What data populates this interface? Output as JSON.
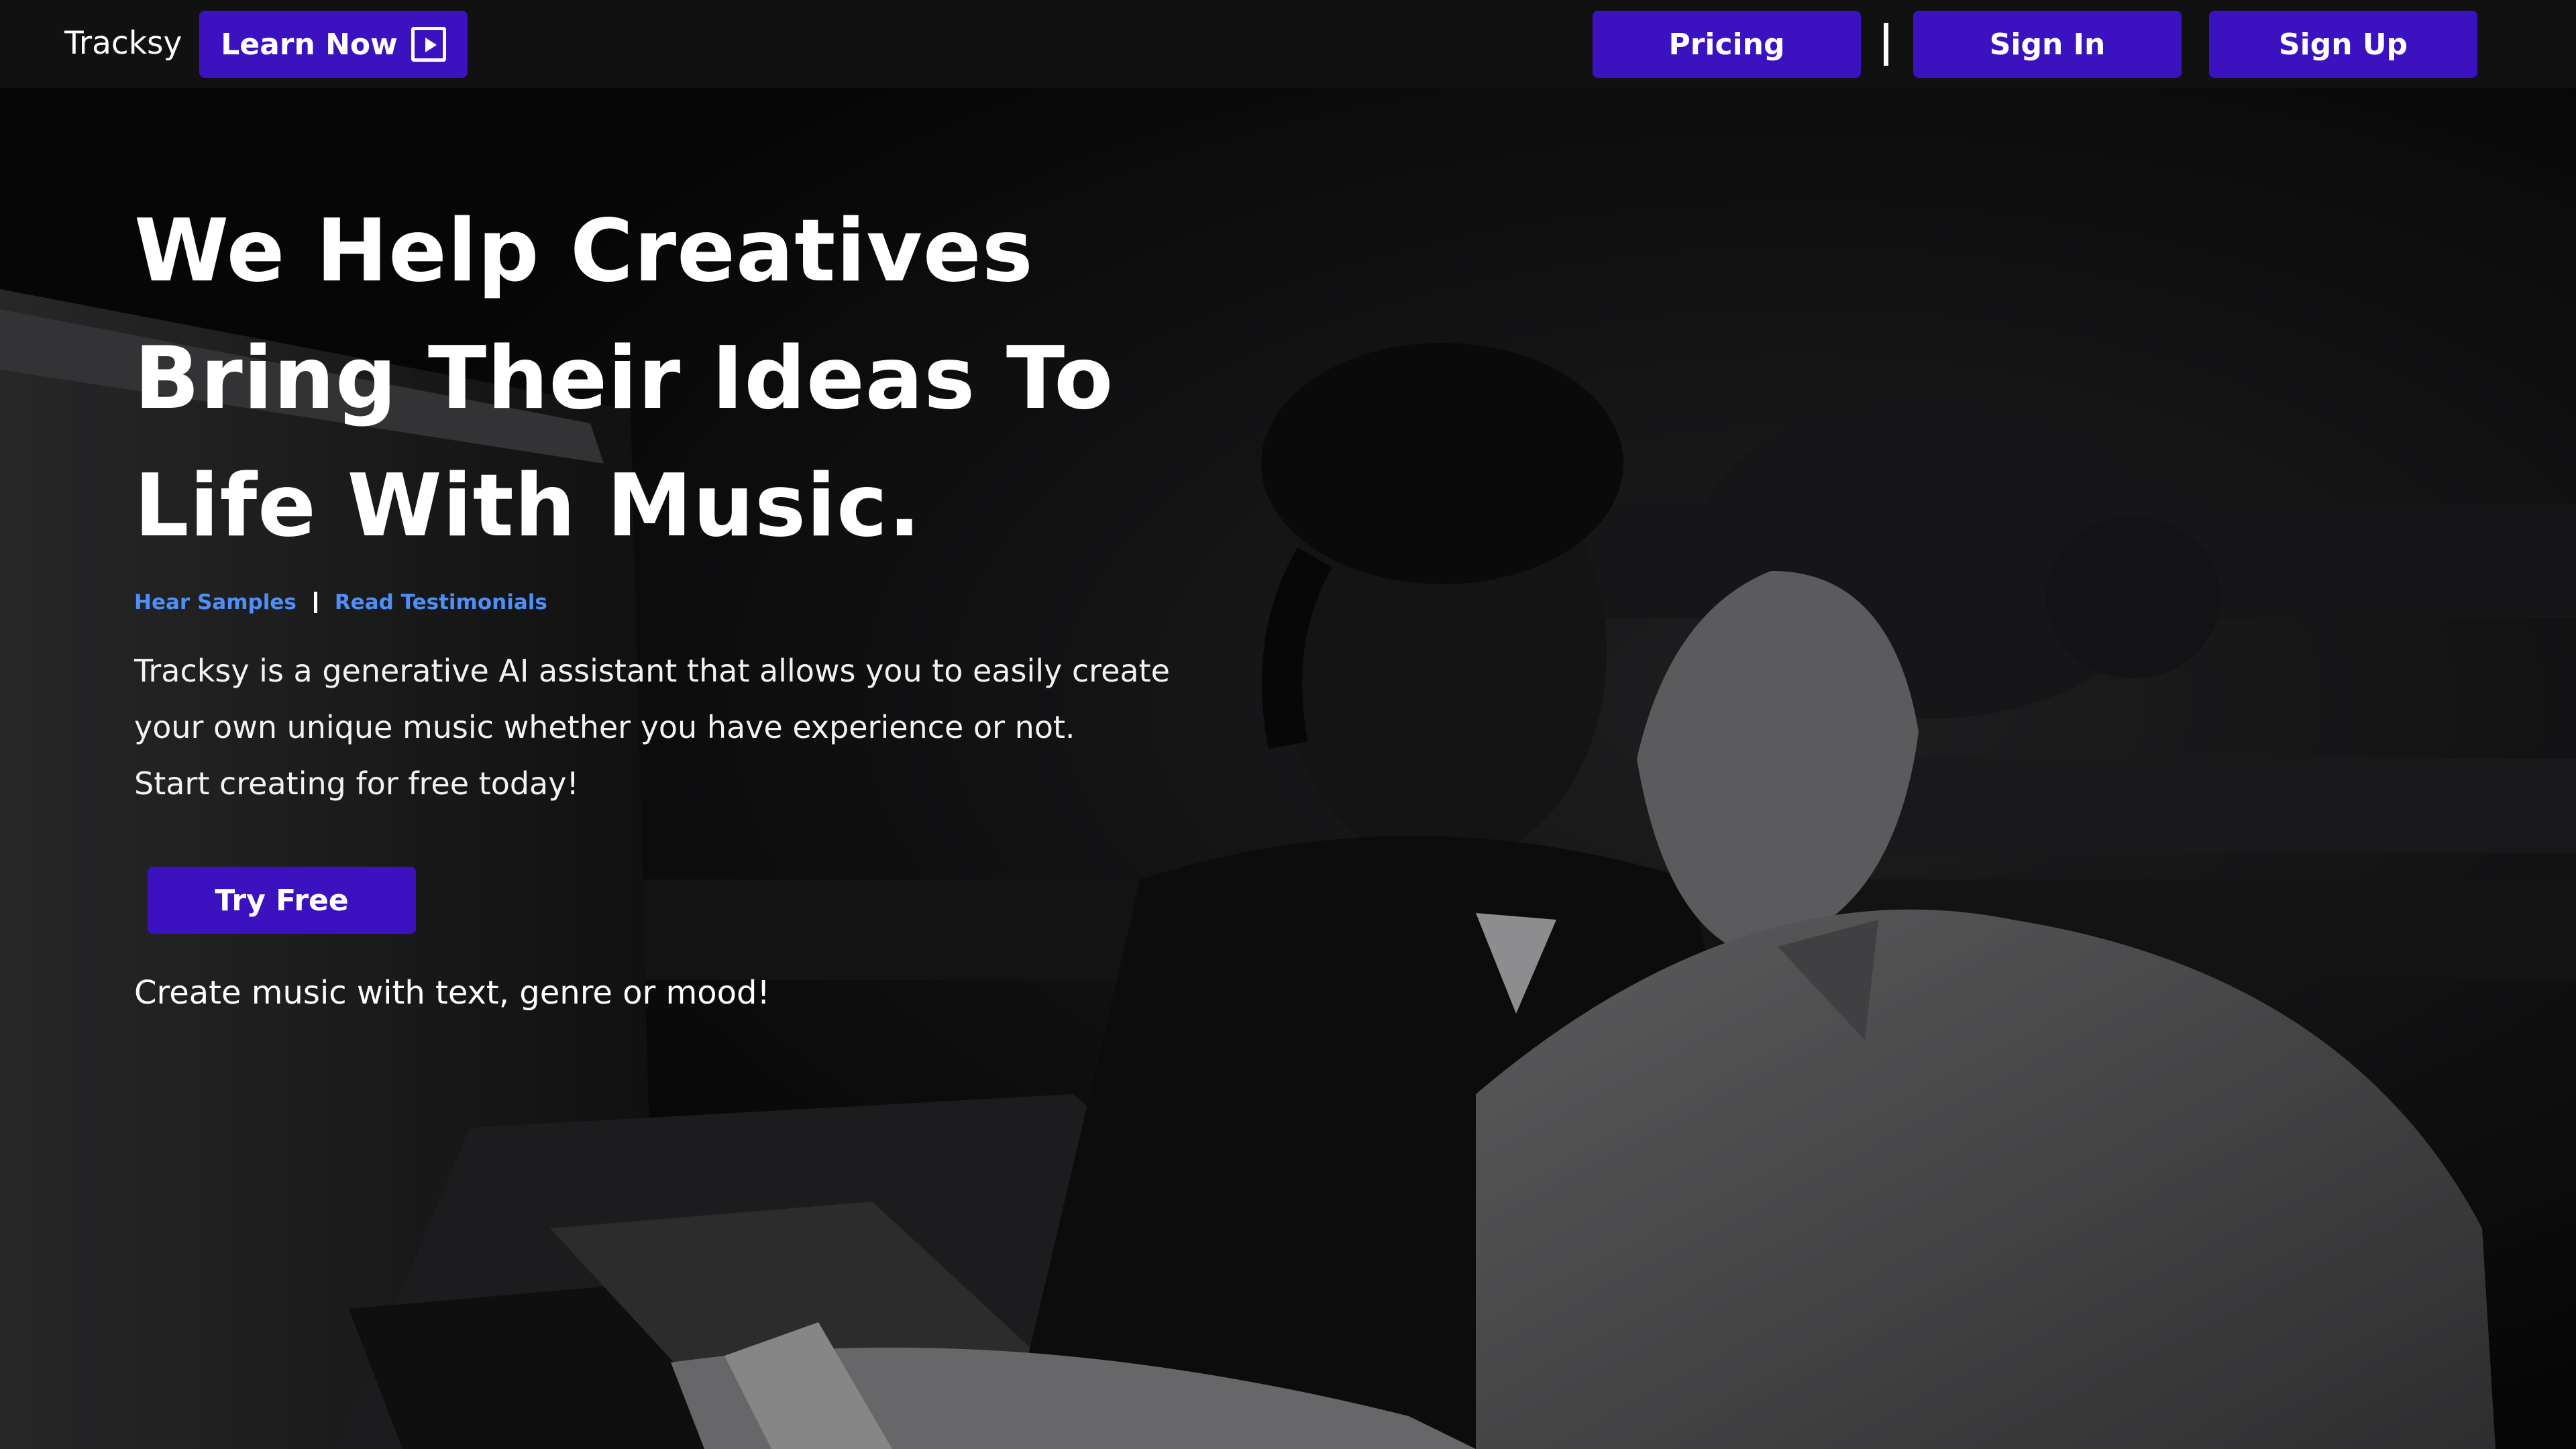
{
  "nav": {
    "brand": "Tracksy",
    "learn_now": "Learn Now",
    "learn_icon": "play-square-icon",
    "pricing": "Pricing",
    "sign_in": "Sign In",
    "sign_up": "Sign Up"
  },
  "hero": {
    "headline_lines": [
      "We Help Creatives",
      "Bring Their Ideas To",
      "Life With Music."
    ],
    "links": {
      "hear_samples": "Hear Samples",
      "read_testimonials": "Read Testimonials"
    },
    "description_lines": [
      "Tracksy is a generative AI assistant that allows you to easily create",
      "your own unique music whether you have experience or not.",
      "Start creating for free today!"
    ],
    "cta": "Try Free",
    "tagline": "Create music with text, genre or mood!"
  },
  "colors": {
    "accent": "#3c12c0",
    "nav_bg": "#111112",
    "link": "#4f8ff7",
    "text": "#ffffff"
  }
}
